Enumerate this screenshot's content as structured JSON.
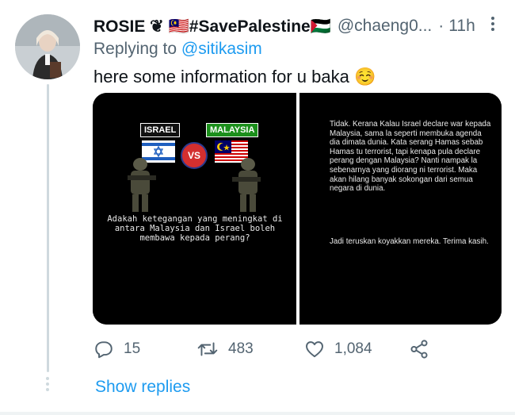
{
  "tweet": {
    "display_name": "ROSIE ❦ 🇲🇾#SavePalestine🇵🇸",
    "handle": "@chaeng0...",
    "separator": "·",
    "time": "11h",
    "replying_prefix": "Replying to",
    "replying_to": "@sitikasim",
    "text": "here some information for u baka ☺️"
  },
  "media": {
    "left_image": {
      "label_israel": "ISRAEL",
      "label_malaysia": "MALAYSIA",
      "vs": "VS",
      "question": "Adakah ketegangan yang meningkat di antara Malaysia dan Israel boleh membawa kepada perang?"
    },
    "right_image": {
      "paragraph_1": "Tidak. Kerana Kalau Israel declare war kepada Malaysia, sama la seperti membuka agenda dia dimata dunia. Kata serang Hamas sebab Hamas tu terrorist, tapi kenapa pula declare perang dengan Malaysia? Nanti nampak la sebenarnya yang diorang ni terrorist. Maka akan hilang banyak sokongan dari semua negara di dunia.",
      "paragraph_2": "Jadi teruskan koyakkan mereka. Terima kasih."
    }
  },
  "actions": {
    "replies": "15",
    "retweets": "483",
    "likes": "1,084"
  },
  "show_replies": "Show replies",
  "icons": [
    "reply-icon",
    "retweet-icon",
    "like-icon",
    "share-icon",
    "more-icon"
  ],
  "colors": {
    "accent": "#1d9bf0",
    "muted": "#536471",
    "text": "#0f1419"
  }
}
